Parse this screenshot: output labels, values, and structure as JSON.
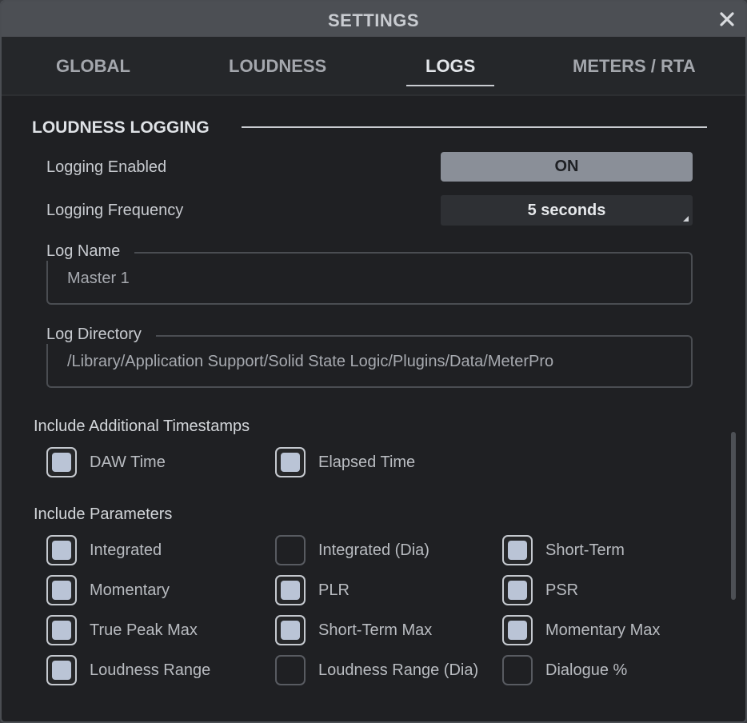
{
  "window": {
    "title": "SETTINGS"
  },
  "tabs": [
    {
      "label": "GLOBAL",
      "active": false
    },
    {
      "label": "LOUDNESS",
      "active": false
    },
    {
      "label": "LOGS",
      "active": true
    },
    {
      "label": "METERS / RTA",
      "active": false
    }
  ],
  "section": {
    "title": "LOUDNESS LOGGING"
  },
  "logging_enabled": {
    "label": "Logging Enabled",
    "value": "ON"
  },
  "logging_frequency": {
    "label": "Logging Frequency",
    "value": "5 seconds"
  },
  "log_name": {
    "label": "Log Name",
    "value": "Master 1"
  },
  "log_directory": {
    "label": "Log Directory",
    "value": "/Library/Application Support/Solid State Logic/Plugins/Data/MeterPro"
  },
  "timestamps": {
    "title": "Include Additional Timestamps",
    "items": [
      {
        "label": "DAW Time",
        "checked": true
      },
      {
        "label": "Elapsed Time",
        "checked": true
      }
    ]
  },
  "parameters": {
    "title": "Include Parameters",
    "items": [
      {
        "label": "Integrated",
        "checked": true
      },
      {
        "label": "Integrated (Dia)",
        "checked": false
      },
      {
        "label": "Short-Term",
        "checked": true
      },
      {
        "label": "Momentary",
        "checked": true
      },
      {
        "label": "PLR",
        "checked": true
      },
      {
        "label": "PSR",
        "checked": true
      },
      {
        "label": "True Peak Max",
        "checked": true
      },
      {
        "label": "Short-Term Max",
        "checked": true
      },
      {
        "label": "Momentary Max",
        "checked": true
      },
      {
        "label": "Loudness Range",
        "checked": true
      },
      {
        "label": "Loudness Range (Dia)",
        "checked": false
      },
      {
        "label": "Dialogue %",
        "checked": false
      }
    ]
  },
  "colors": {
    "background": "#1f2023",
    "accent": "#bac4d6",
    "toggle_on": "#8a8f98"
  }
}
